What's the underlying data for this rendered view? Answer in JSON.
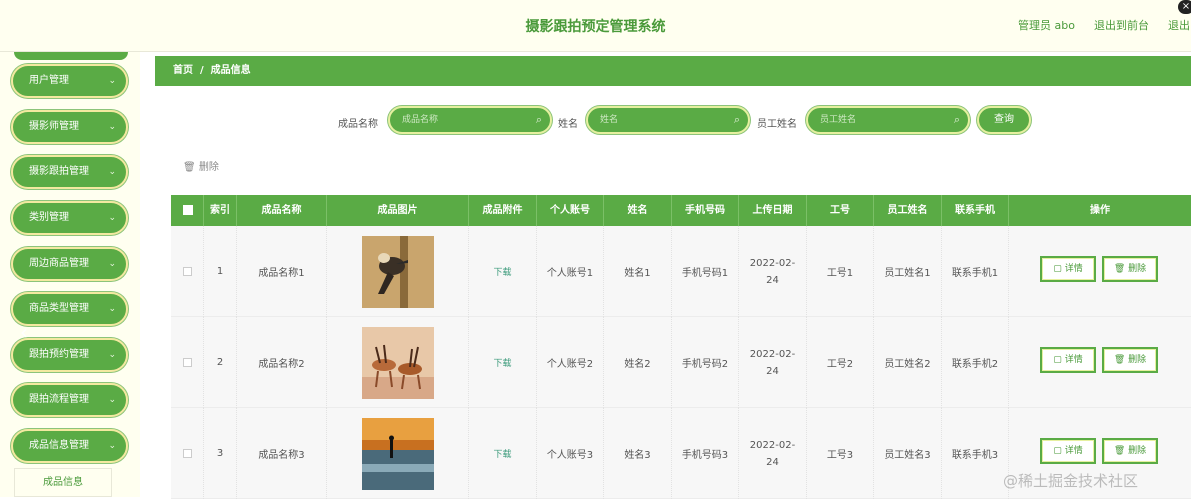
{
  "header": {
    "title": "摄影跟拍预定管理系统",
    "admin": "管理员 abo",
    "exit_front": "退出到前台",
    "exit": "退出"
  },
  "sidebar": {
    "items": [
      {
        "label": "用户管理"
      },
      {
        "label": "摄影师管理"
      },
      {
        "label": "摄影跟拍管理"
      },
      {
        "label": "类别管理"
      },
      {
        "label": "周边商品管理"
      },
      {
        "label": "商品类型管理"
      },
      {
        "label": "跟拍预约管理"
      },
      {
        "label": "跟拍流程管理"
      },
      {
        "label": "成品信息管理"
      }
    ],
    "sub_item": "成品信息"
  },
  "breadcrumb": {
    "home": "首页",
    "separator": "/",
    "current": "成品信息"
  },
  "search": {
    "name_label": "成品名称",
    "name_placeholder": "成品名称",
    "person_label": "姓名",
    "person_placeholder": "姓名",
    "staff_label": "员工姓名",
    "staff_placeholder": "员工姓名",
    "button": "查询"
  },
  "toolbar": {
    "delete_label": "删除"
  },
  "table": {
    "headers": [
      "索引",
      "成品名称",
      "成品图片",
      "成品附件",
      "个人账号",
      "姓名",
      "手机号码",
      "上传日期",
      "工号",
      "员工姓名",
      "联系手机",
      "操作"
    ],
    "rows": [
      {
        "index": "1",
        "name": "成品名称1",
        "attachment": "下载",
        "account": "个人账号1",
        "person": "姓名1",
        "phone": "手机号码1",
        "date": "2022-02-24",
        "staff_no": "工号1",
        "staff_name": "员工姓名1",
        "contact": "联系手机1",
        "image": "woodpecker-on-tree"
      },
      {
        "index": "2",
        "name": "成品名称2",
        "attachment": "下载",
        "account": "个人账号2",
        "person": "姓名2",
        "phone": "手机号码2",
        "date": "2022-02-24",
        "staff_no": "工号2",
        "staff_name": "员工姓名2",
        "contact": "联系手机2",
        "image": "antelopes-drinking"
      },
      {
        "index": "3",
        "name": "成品名称3",
        "attachment": "下载",
        "account": "个人账号3",
        "person": "姓名3",
        "phone": "手机号码3",
        "date": "2022-02-24",
        "staff_no": "工号3",
        "staff_name": "员工姓名3",
        "contact": "联系手机3",
        "image": "person-at-sunset-lake"
      }
    ],
    "detail_label": "详情",
    "delete_label": "删除"
  },
  "watermark": "@稀土掘金技术社区",
  "colors": {
    "primary_green": "#5aab45",
    "cream": "#fffff0",
    "title_green": "#4a9a3a"
  }
}
